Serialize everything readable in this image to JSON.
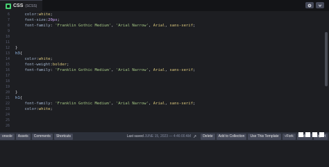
{
  "tab": {
    "label": "CSS",
    "sub": "(SCSS)"
  },
  "toolbar": {
    "settings_icon": "gear-icon",
    "collapse_icon": "chevron-down-icon"
  },
  "lines": [
    {
      "n": "6",
      "segments": [
        {
          "t": "    "
        },
        {
          "t": "color",
          "c": "prop"
        },
        {
          "t": ":"
        },
        {
          "t": "white",
          "c": "val"
        },
        {
          "t": ";"
        }
      ]
    },
    {
      "n": "7",
      "segments": [
        {
          "t": "    "
        },
        {
          "t": "font-size",
          "c": "prop"
        },
        {
          "t": ":"
        },
        {
          "t": "20px",
          "c": "num"
        },
        {
          "t": ";"
        }
      ]
    },
    {
      "n": "8",
      "segments": [
        {
          "t": "    "
        },
        {
          "t": "font-family",
          "c": "prop"
        },
        {
          "t": ": "
        },
        {
          "t": "'Franklin Gothic Medium'",
          "c": "str"
        },
        {
          "t": ", "
        },
        {
          "t": "'Arial Narrow'",
          "c": "str"
        },
        {
          "t": ", "
        },
        {
          "t": "Arial",
          "c": "val"
        },
        {
          "t": ", "
        },
        {
          "t": "sans-serif",
          "c": "val"
        },
        {
          "t": ";"
        }
      ]
    },
    {
      "n": "9",
      "segments": []
    },
    {
      "n": "10",
      "segments": []
    },
    {
      "n": "11",
      "segments": []
    },
    {
      "n": "12",
      "segments": [
        {
          "t": "}"
        }
      ]
    },
    {
      "n": "13",
      "segments": [
        {
          "t": "h3",
          "c": "sel"
        },
        {
          "t": "{"
        }
      ]
    },
    {
      "n": "14",
      "segments": [
        {
          "t": "    "
        },
        {
          "t": "color",
          "c": "prop"
        },
        {
          "t": ":"
        },
        {
          "t": "white",
          "c": "val"
        },
        {
          "t": ";"
        }
      ]
    },
    {
      "n": "15",
      "segments": [
        {
          "t": "    "
        },
        {
          "t": "font-weight",
          "c": "prop"
        },
        {
          "t": ":"
        },
        {
          "t": "bolder",
          "c": "val"
        },
        {
          "t": ";"
        }
      ]
    },
    {
      "n": "16",
      "segments": [
        {
          "t": "    "
        },
        {
          "t": "font-family",
          "c": "prop"
        },
        {
          "t": ": "
        },
        {
          "t": "'Franklin Gothic Medium'",
          "c": "str"
        },
        {
          "t": ", "
        },
        {
          "t": "'Arial Narrow'",
          "c": "str"
        },
        {
          "t": ", "
        },
        {
          "t": "Arial",
          "c": "val"
        },
        {
          "t": ", "
        },
        {
          "t": "sans-serif",
          "c": "val"
        },
        {
          "t": ";"
        }
      ]
    },
    {
      "n": "17",
      "segments": []
    },
    {
      "n": "18",
      "segments": []
    },
    {
      "n": "19",
      "segments": []
    },
    {
      "n": "20",
      "segments": [
        {
          "t": "}"
        }
      ]
    },
    {
      "n": "21",
      "segments": [
        {
          "t": "h1",
          "c": "sel"
        },
        {
          "t": "{"
        }
      ]
    },
    {
      "n": "22",
      "segments": [
        {
          "t": "    "
        },
        {
          "t": "font-family",
          "c": "prop"
        },
        {
          "t": ": "
        },
        {
          "t": "'Franklin Gothic Medium'",
          "c": "str"
        },
        {
          "t": ", "
        },
        {
          "t": "'Arial Narrow'",
          "c": "str"
        },
        {
          "t": ", "
        },
        {
          "t": "Arial",
          "c": "val"
        },
        {
          "t": ", "
        },
        {
          "t": "sans-serif",
          "c": "val"
        },
        {
          "t": ";"
        }
      ]
    },
    {
      "n": "23",
      "segments": [
        {
          "t": "    "
        },
        {
          "t": "color",
          "c": "prop"
        },
        {
          "t": ":"
        },
        {
          "t": "white",
          "c": "val"
        },
        {
          "t": ";"
        }
      ]
    },
    {
      "n": "24",
      "segments": []
    },
    {
      "n": "25",
      "segments": []
    },
    {
      "n": "26",
      "segments": []
    }
  ],
  "footer": {
    "buttons_left": [
      "onsole",
      "Assets",
      "Comments",
      "Shortcuts"
    ],
    "saved_label": "Last saved",
    "saved_time": "JUNE 15, 2023 — 4:46:00 AM",
    "buttons_right": [
      "Delete",
      "Add to Collection",
      "Use This Template",
      "Fork",
      "Embed",
      "Export"
    ]
  },
  "colors": {
    "background": "#1d1e22",
    "topbar": "#131417",
    "footer": "#2c303a",
    "accent": "#47cf73"
  }
}
